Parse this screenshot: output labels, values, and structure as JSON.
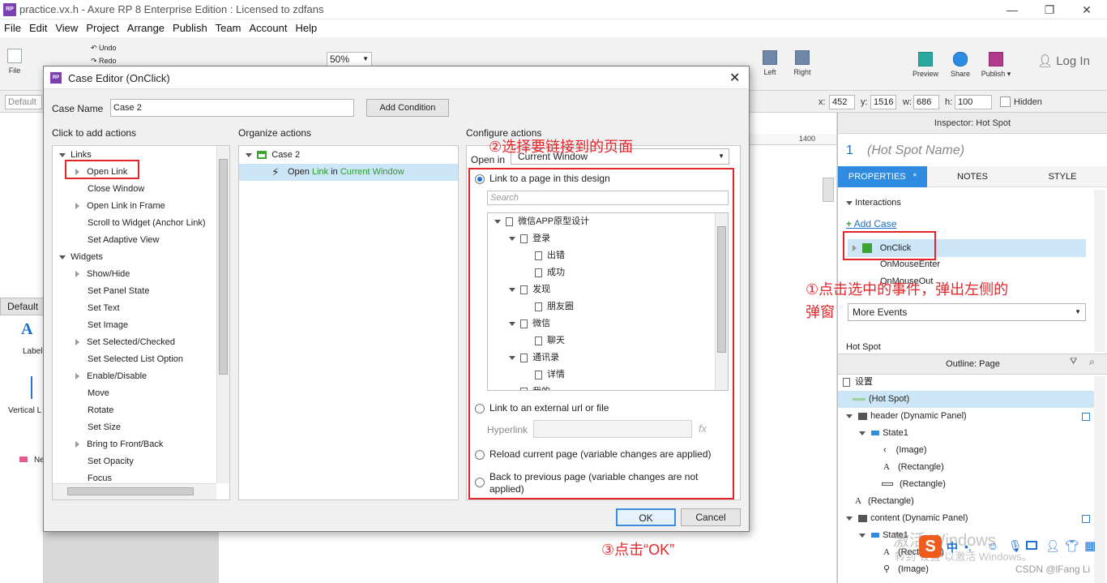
{
  "window": {
    "title": "practice.vx.h - Axure RP 8 Enterprise Edition : Licensed to zdfans",
    "app_icon": "RP"
  },
  "menu": [
    "File",
    "Edit",
    "View",
    "Project",
    "Arrange",
    "Publish",
    "Team",
    "Account",
    "Help"
  ],
  "toolbar": {
    "file": "File",
    "undo": "Undo",
    "redo": "Redo",
    "zoom": "50%",
    "left": "Left",
    "right": "Right",
    "preview": "Preview",
    "share": "Share",
    "publish": "Publish ▾",
    "login": "Log In"
  },
  "propbar": {
    "style": "Default",
    "x_label": "x:",
    "x": "452",
    "y_label": "y:",
    "y": "1516",
    "w_label": "w:",
    "w": "686",
    "h_label": "h:",
    "h": "100",
    "hidden": "Hidden"
  },
  "left_panel": {
    "style": "Default",
    "widget1": "Label",
    "widget2": "Vertical L",
    "page_item": "Ne"
  },
  "ruler": {
    "mark": "1400"
  },
  "inspector": {
    "header": "Inspector: Hot Spot",
    "number": "1",
    "name_placeholder": "(Hot Spot Name)",
    "tabs": [
      "PROPERTIES",
      "NOTES",
      "STYLE"
    ],
    "interactions": "Interactions",
    "add_case": "Add Case",
    "events": [
      "OnClick",
      "OnMouseEnter",
      "OnMouseOut"
    ],
    "more_events": "More Events",
    "section": "Hot Spot",
    "outline_header": "Outline: Page",
    "outline": [
      "设置",
      "(Hot Spot)",
      "header (Dynamic Panel)",
      "State1",
      "(Image)",
      "(Rectangle)",
      "(Rectangle)",
      "(Rectangle)",
      "content (Dynamic Panel)",
      "State1",
      "(Rectangle)",
      "(Image)"
    ]
  },
  "dialog": {
    "title": "Case Editor (OnClick)",
    "case_name_label": "Case Name",
    "case_name": "Case 2",
    "add_condition": "Add Condition",
    "col1_title": "Click to add actions",
    "col2_title": "Organize actions",
    "col3_title": "Configure actions",
    "actions": [
      {
        "label": "Links",
        "kind": "group"
      },
      {
        "label": "Open Link",
        "kind": "item",
        "expand": true
      },
      {
        "label": "Close Window",
        "kind": "item"
      },
      {
        "label": "Open Link in Frame",
        "kind": "item",
        "expand": true
      },
      {
        "label": "Scroll to Widget (Anchor Link)",
        "kind": "item"
      },
      {
        "label": "Set Adaptive View",
        "kind": "item"
      },
      {
        "label": "Widgets",
        "kind": "group"
      },
      {
        "label": "Show/Hide",
        "kind": "item",
        "expand": true
      },
      {
        "label": "Set Panel State",
        "kind": "item"
      },
      {
        "label": "Set Text",
        "kind": "item"
      },
      {
        "label": "Set Image",
        "kind": "item"
      },
      {
        "label": "Set Selected/Checked",
        "kind": "item",
        "expand": true
      },
      {
        "label": "Set Selected List Option",
        "kind": "item"
      },
      {
        "label": "Enable/Disable",
        "kind": "item",
        "expand": true
      },
      {
        "label": "Move",
        "kind": "item"
      },
      {
        "label": "Rotate",
        "kind": "item"
      },
      {
        "label": "Set Size",
        "kind": "item"
      },
      {
        "label": "Bring to Front/Back",
        "kind": "item",
        "expand": true
      },
      {
        "label": "Set Opacity",
        "kind": "item"
      },
      {
        "label": "Focus",
        "kind": "item"
      }
    ],
    "organize": {
      "case": "Case 2",
      "action_prefix": "Open ",
      "action_link": "Link",
      "action_mid": " in ",
      "action_target": "Current Window"
    },
    "open_in_label": "Open in",
    "open_in_value": "Current Window",
    "opt_link_page": "Link to a page in this design",
    "search_placeholder": "Search",
    "pages": [
      {
        "label": "微信APP原型设计",
        "level": 0,
        "expand": true
      },
      {
        "label": "登录",
        "level": 1,
        "expand": true
      },
      {
        "label": "出错",
        "level": 2
      },
      {
        "label": "成功",
        "level": 2
      },
      {
        "label": "发现",
        "level": 1,
        "expand": true
      },
      {
        "label": "朋友圈",
        "level": 2
      },
      {
        "label": "微信",
        "level": 1,
        "expand": true
      },
      {
        "label": "聊天",
        "level": 2
      },
      {
        "label": "通讯录",
        "level": 1,
        "expand": true
      },
      {
        "label": "详情",
        "level": 2
      },
      {
        "label": "我的",
        "level": 1,
        "expand": true
      }
    ],
    "opt_external": "Link to an external url or file",
    "hyperlink_label": "Hyperlink",
    "fx": "fx",
    "opt_reload": "Reload current page (variable changes are applied)",
    "opt_back_line1": "Back to previous page (variable changes are not",
    "opt_back_line2": "applied)",
    "ok": "OK",
    "cancel": "Cancel"
  },
  "annotations": {
    "a1_line1": "①点击选中的事件，弹出左侧的",
    "a1_line2": "弹窗",
    "a2": "②选择要链接到的页面",
    "a3": "③点击“OK”"
  },
  "watermark": {
    "line1": "激活 Windows",
    "line2": "转到\"设置\"以激活 Windows。",
    "csdn": "CSDN @lFang Li",
    "ime": "中"
  }
}
